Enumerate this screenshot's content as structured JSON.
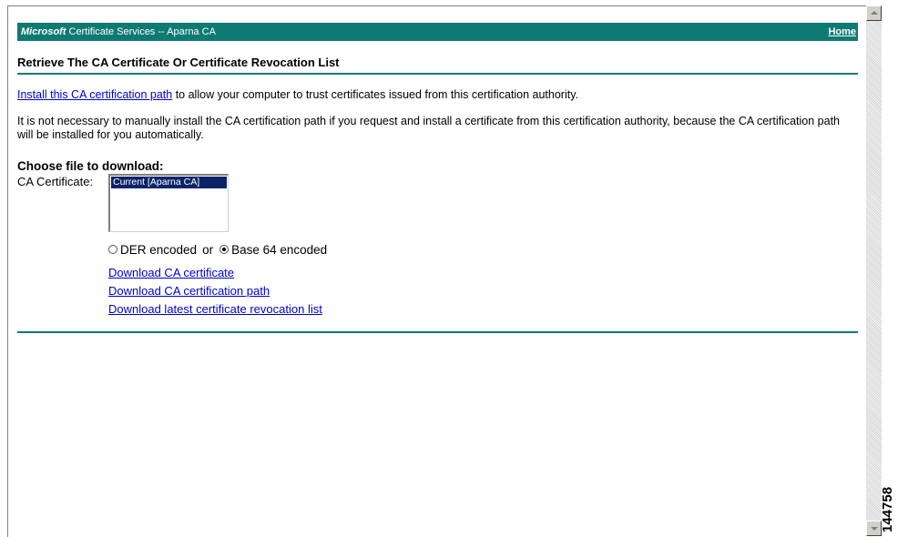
{
  "banner": {
    "brand": "Microsoft",
    "title": " Certificate Services  --  Aparna CA",
    "home": "Home"
  },
  "page_title": "Retrieve The CA Certificate Or Certificate Revocation List",
  "intro": {
    "link": "Install this CA certification path",
    "rest": " to allow your computer to trust certificates issued from this certification authority."
  },
  "note": "It is not necessary to manually install the CA certification path if you request and install a certificate from this certification authority, because the CA certification path will be installed for you automatically.",
  "choose_heading": "Choose file to download:",
  "ca_certificate": {
    "label": "CA Certificate:",
    "options": [
      "Current [Aparna CA]"
    ],
    "selected": "Current [Aparna CA]"
  },
  "encoding": {
    "der": "DER encoded",
    "or": "or",
    "base64": "Base 64 encoded",
    "selected": "base64"
  },
  "downloads": [
    "Download CA certificate",
    "Download CA certification path",
    "Download latest certificate revocation list"
  ],
  "figure_id": "144758",
  "colors": {
    "banner": "#0f7a74",
    "link": "#0000cc",
    "selection": "#0a246a"
  }
}
